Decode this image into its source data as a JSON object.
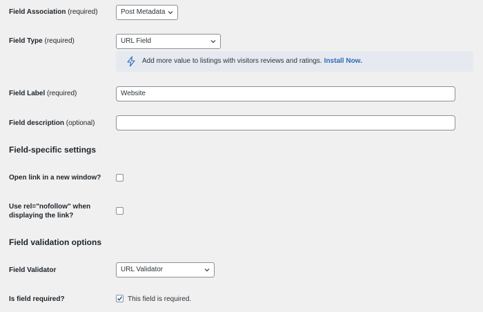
{
  "fields": {
    "association": {
      "label": "Field Association",
      "req": "(required)",
      "value": "Post Metadata"
    },
    "type": {
      "label": "Field Type",
      "req": "(required)",
      "value": "URL Field"
    },
    "notice": {
      "text": "Add more value to listings with visitors reviews and ratings.",
      "link": "Install Now."
    },
    "label_field": {
      "label": "Field Label",
      "req": "(required)",
      "value": "Website"
    },
    "description": {
      "label": "Field description",
      "req": "(optional)",
      "value": ""
    }
  },
  "specific": {
    "heading": "Field-specific settings",
    "new_window": {
      "label": "Open link in a new window?",
      "checked": false
    },
    "nofollow": {
      "label_line1": "Use rel=\"nofollow\" when",
      "label_line2": "displaying the link?",
      "checked": false
    }
  },
  "validation": {
    "heading": "Field validation options",
    "validator": {
      "label": "Field Validator",
      "value": "URL Validator"
    },
    "required": {
      "label": "Is field required?",
      "checkbox_text": "This field is required.",
      "checked": true
    }
  }
}
